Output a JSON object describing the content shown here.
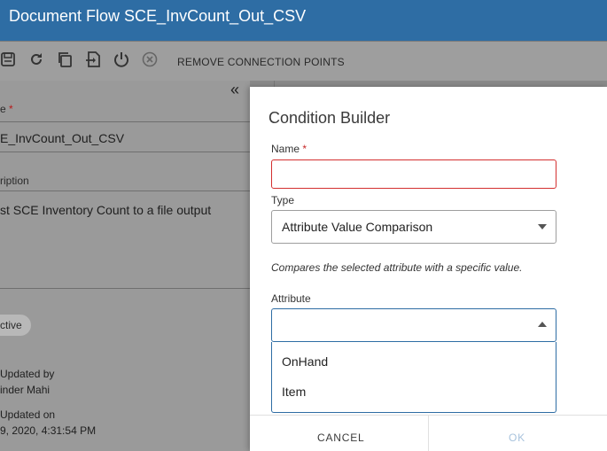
{
  "window": {
    "title": "Document Flow SCE_InvCount_Out_CSV"
  },
  "toolbar": {
    "icons": [
      "save-icon",
      "refresh-icon",
      "copy-icon",
      "import-icon",
      "power-icon",
      "cancel-circle-icon"
    ],
    "remove_label": "REMOVE CONNECTION POINTS"
  },
  "left_panel": {
    "name_label": "e",
    "name_required": "*",
    "name_value": "E_InvCount_Out_CSV",
    "description_label": "ription",
    "description_value": "st SCE Inventory Count to a file output",
    "status_chip": "ctive",
    "updated_by_label": "Updated by",
    "updated_by_value": "inder Mahi",
    "updated_on_label": "Updated on",
    "updated_on_value": "9, 2020, 4:31:54 PM"
  },
  "dialog": {
    "title": "Condition Builder",
    "name_label": "Name",
    "name_required": "*",
    "name_value": "",
    "type_label": "Type",
    "type_value": "Attribute Value Comparison",
    "type_description": "Compares the selected attribute with a specific value.",
    "attribute_label": "Attribute",
    "attribute_value": "",
    "attribute_options": [
      "OnHand",
      "Item"
    ],
    "cancel_label": "CANCEL",
    "ok_label": "OK"
  },
  "colors": {
    "title_bar": "#2e6da4",
    "required": "#d32f2f",
    "focus": "#2e6da4",
    "ok_disabled": "#a8c3dd"
  }
}
